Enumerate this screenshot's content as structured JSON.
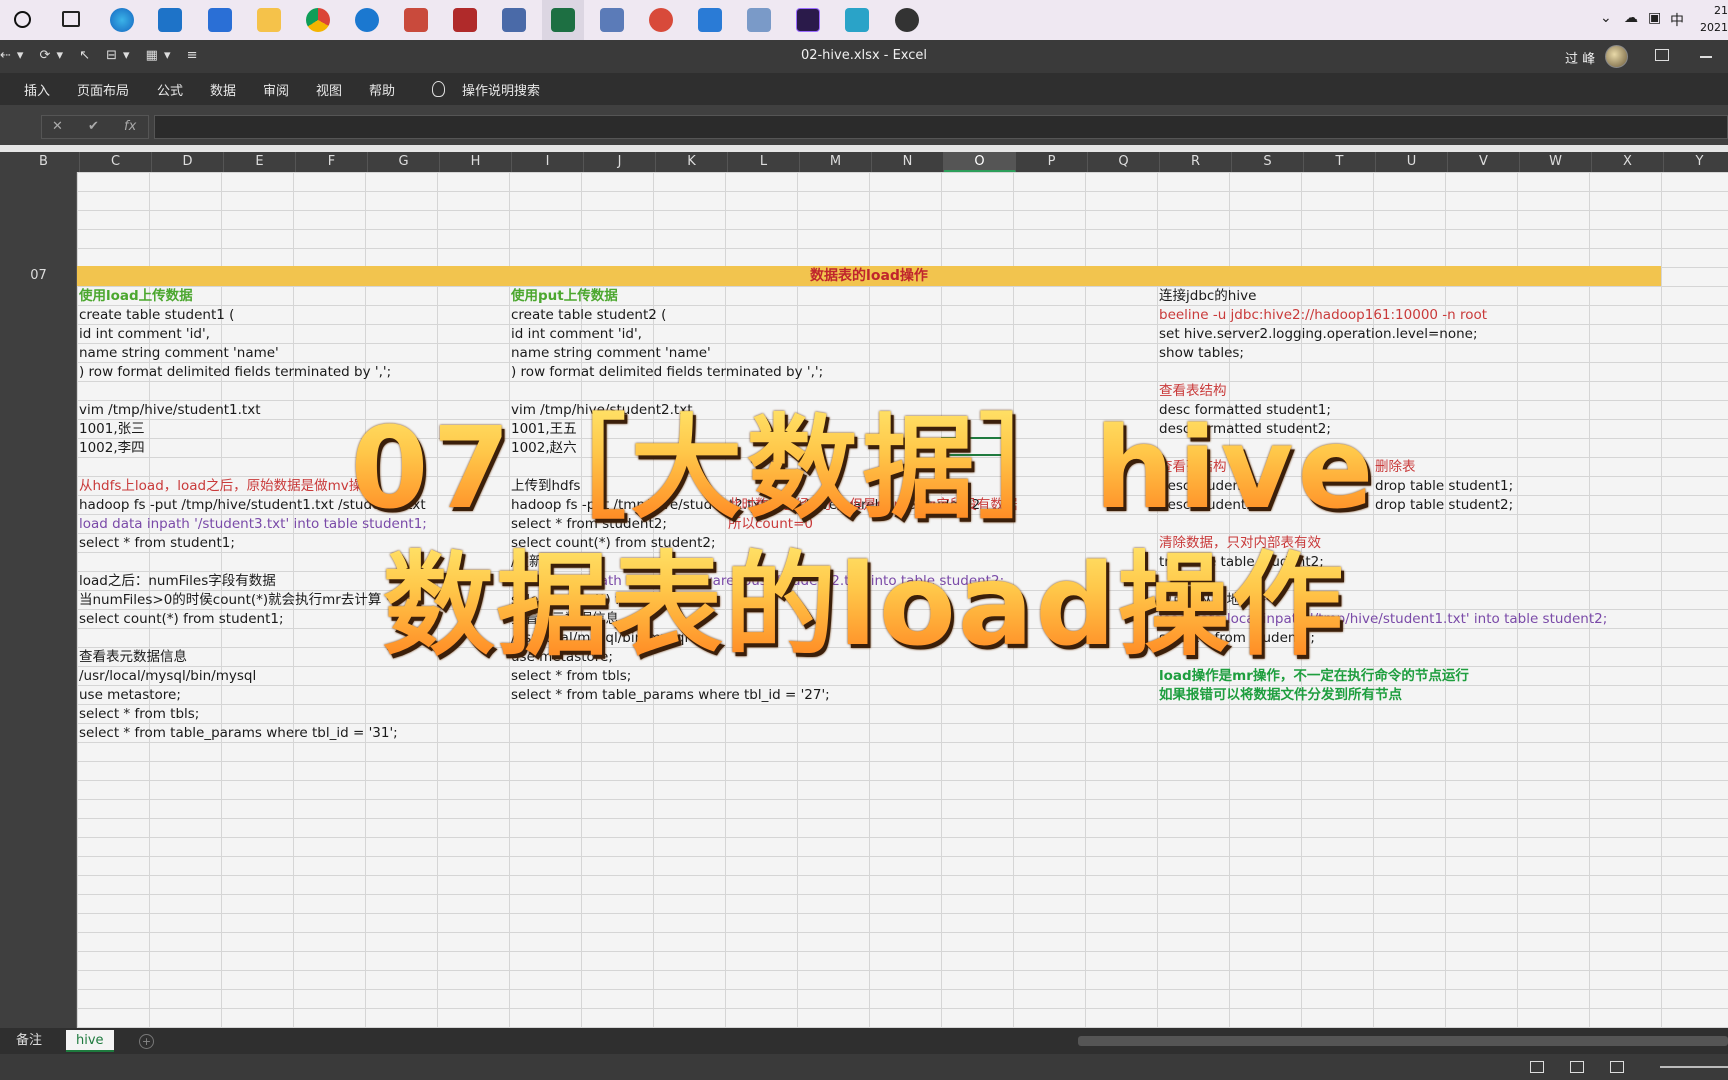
{
  "window": {
    "title": "02-hive.xlsx  -  Excel",
    "user": "过 峰",
    "clock_line1": "21",
    "clock_line2": "2021"
  },
  "taskbar": {
    "tray_ime": "中",
    "apps": [
      "edge",
      "mail",
      "store",
      "explorer",
      "chrome",
      "teamviewer",
      "app",
      "app",
      "app",
      "excel",
      "app",
      "app",
      "app",
      "premiere",
      "app",
      "obs"
    ]
  },
  "menu": [
    "插入",
    "页面布局",
    "公式",
    "数据",
    "审阅",
    "视图",
    "帮助"
  ],
  "tell_me": "操作说明搜索",
  "formula_bar": {
    "cancel": "✕",
    "enter": "✔",
    "fx": "fx",
    "value": ""
  },
  "columns": [
    "B",
    "C",
    "D",
    "E",
    "F",
    "G",
    "H",
    "I",
    "J",
    "K",
    "L",
    "M",
    "N",
    "O",
    "P",
    "Q",
    "R",
    "S",
    "T",
    "U",
    "V",
    "W",
    "X",
    "Y"
  ],
  "active_column": "O",
  "row_label": "07",
  "banner": "数据表的load操作",
  "left_block": [
    {
      "text": "使用load上传数据",
      "style": "green"
    },
    {
      "text": "create table student1 (",
      "style": ""
    },
    {
      "text": "id int comment 'id',",
      "style": ""
    },
    {
      "text": "name string comment 'name'",
      "style": ""
    },
    {
      "text": ") row format delimited fields terminated by ',';",
      "style": ""
    },
    {
      "text": "",
      "style": ""
    },
    {
      "text": "vim /tmp/hive/student1.txt",
      "style": ""
    },
    {
      "text": "1001,张三",
      "style": ""
    },
    {
      "text": "1002,李四",
      "style": ""
    },
    {
      "text": "",
      "style": ""
    },
    {
      "text": "从hdfs上load，load之后，原始数据是做mv操作",
      "style": "red"
    },
    {
      "text": "hadoop fs -put /tmp/hive/student1.txt /student3.txt",
      "style": ""
    },
    {
      "text": "load data inpath '/student3.txt' into table student1;",
      "style": "purple"
    },
    {
      "text": "select * from student1;",
      "style": ""
    },
    {
      "text": "",
      "style": ""
    },
    {
      "text": "load之后：numFiles字段有数据",
      "style": ""
    },
    {
      "text": "当numFiles>0的时侯count(*)就会执行mr去计算",
      "style": ""
    },
    {
      "text": "select count(*) from student1;",
      "style": ""
    },
    {
      "text": "",
      "style": ""
    },
    {
      "text": "查看表元数据信息",
      "style": ""
    },
    {
      "text": "/usr/local/mysql/bin/mysql",
      "style": ""
    },
    {
      "text": "use metastore;",
      "style": ""
    },
    {
      "text": "select * from tbls;",
      "style": ""
    },
    {
      "text": "select * from table_params where tbl_id = '31';",
      "style": ""
    }
  ],
  "mid_block": [
    {
      "text": "使用put上传数据",
      "style": "green"
    },
    {
      "text": "create table student2 (",
      "style": ""
    },
    {
      "text": "id int comment 'id',",
      "style": ""
    },
    {
      "text": "name string comment 'name'",
      "style": ""
    },
    {
      "text": ") row format delimited fields terminated by ',';",
      "style": ""
    },
    {
      "text": "",
      "style": ""
    },
    {
      "text": "vim /tmp/hive/student2.txt",
      "style": ""
    },
    {
      "text": "1001,王五",
      "style": ""
    },
    {
      "text": "1002,赵六",
      "style": ""
    },
    {
      "text": "",
      "style": ""
    },
    {
      "text": "上传到hdfs",
      "style": ""
    },
    {
      "text": "hadoop fs -put /tmp/hive/student2.txt /user/hive/warehouse/student2",
      "style": ""
    },
    {
      "text": "select * from student2;",
      "style": ""
    },
    {
      "text": "select count(*) from student2;",
      "style": ""
    },
    {
      "text": "/重新load数据",
      "style": ""
    },
    {
      "text": "load data inpath '/user/hive/warehouse/student2.txt' into table student2;",
      "style": "purple"
    },
    {
      "text": "select count(*) from student2;",
      "style": ""
    },
    {
      "text": "查看表元数据信息",
      "style": ""
    },
    {
      "text": "/usr/local/mysql/bin/mysql",
      "style": ""
    },
    {
      "text": "use metastore;",
      "style": ""
    },
    {
      "text": "select * from tbls;",
      "style": ""
    },
    {
      "text": "select * from table_params where tbl_id = '27';",
      "style": ""
    }
  ],
  "mid_notes": {
    "note1": "此时数据已经有了，但是numFiles字段没有数据",
    "note2": "所以count=0"
  },
  "right_block": [
    {
      "text": "连接jdbc的hive",
      "style": ""
    },
    {
      "text": "beeline -u jdbc:hive2://hadoop161:10000 -n root",
      "style": "red"
    },
    {
      "text": "set hive.server2.logging.operation.level=none;",
      "style": ""
    },
    {
      "text": "show tables;",
      "style": ""
    },
    {
      "text": "",
      "style": ""
    },
    {
      "text": "查看表结构",
      "style": "red"
    },
    {
      "text": "desc formatted student1;",
      "style": ""
    },
    {
      "text": "desc formatted student2;",
      "style": ""
    },
    {
      "text": "",
      "style": ""
    },
    {
      "text": "查看列结构",
      "style": "red"
    },
    {
      "text": "desc student1;",
      "style": ""
    },
    {
      "text": "desc student2;",
      "style": ""
    },
    {
      "text": "",
      "style": ""
    },
    {
      "text": "清除数据，只对内部表有效",
      "style": "red"
    },
    {
      "text": "truncate table student2;",
      "style": ""
    },
    {
      "text": "",
      "style": ""
    },
    {
      "text": "也可以从本地上传",
      "style": ""
    },
    {
      "text": "load data local inpath '/tmp/hive/student1.txt' into table student2;",
      "style": "purple"
    },
    {
      "text": "select * from student2;",
      "style": ""
    },
    {
      "text": "",
      "style": ""
    },
    {
      "text": "load操作是mr操作，不一定在执行命令的节点运行",
      "style": "green2"
    },
    {
      "text": "如果报错可以将数据文件分发到所有节点",
      "style": "green2"
    }
  ],
  "drop_block": [
    {
      "text": "删除表",
      "style": "red"
    },
    {
      "text": "drop table student1;",
      "style": ""
    },
    {
      "text": "drop table student2;",
      "style": ""
    }
  ],
  "overlay": {
    "line1": "07［大数据］hive",
    "line2": "数据表的load操作"
  },
  "sheets": [
    "备注",
    "hive"
  ],
  "active_sheet": "hive"
}
